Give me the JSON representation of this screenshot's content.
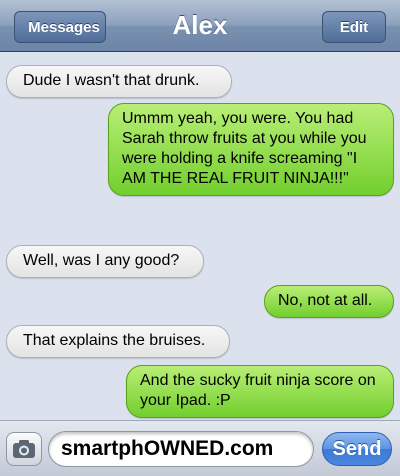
{
  "nav": {
    "back_label": "Messages",
    "title": "Alex",
    "edit_label": "Edit"
  },
  "messages": [
    {
      "direction": "incoming",
      "text": "Dude I wasn't that drunk."
    },
    {
      "direction": "outgoing",
      "text": "Ummm yeah, you were. You had Sarah throw fruits at you while you were holding a knife screaming \"I AM THE REAL FRUIT NINJA!!!\""
    },
    {
      "direction": "incoming",
      "text": "Well, was I any good?"
    },
    {
      "direction": "outgoing",
      "text": "No, not at all."
    },
    {
      "direction": "incoming",
      "text": "That explains the bruises."
    },
    {
      "direction": "outgoing",
      "text": "And the sucky fruit ninja score on your Ipad. :P"
    }
  ],
  "input": {
    "value": "smartphOWNED.com",
    "send_label": "Send",
    "camera_icon": "camera-icon"
  },
  "colors": {
    "outgoing_bubble": "#8ee04a",
    "incoming_bubble": "#ececec",
    "background": "#dbe2ed",
    "navbar": "#7b92b1"
  }
}
